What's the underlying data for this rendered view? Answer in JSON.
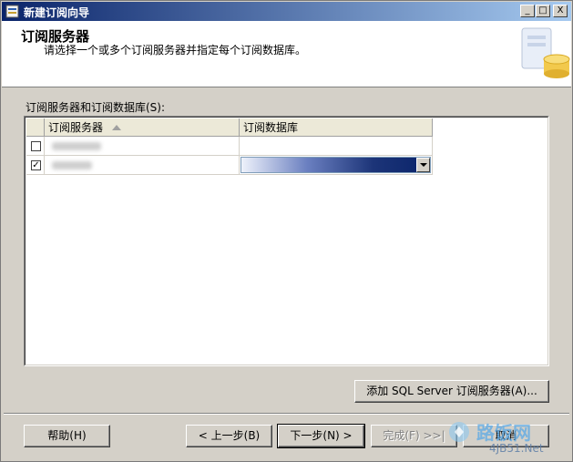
{
  "window": {
    "title": "新建订阅向导",
    "min_glyph": "_",
    "max_glyph": "□",
    "close_glyph": "X"
  },
  "header": {
    "title": "订阅服务器",
    "subtitle": "请选择一个或多个订阅服务器并指定每个订阅数据库。"
  },
  "grid": {
    "label": "订阅服务器和订阅数据库(S):",
    "columns": [
      "订阅服务器",
      "订阅数据库"
    ],
    "rows": [
      {
        "checked": false,
        "check_glyph": ""
      },
      {
        "checked": true,
        "check_glyph": "✓"
      }
    ]
  },
  "buttons": {
    "add": "添加 SQL Server 订阅服务器(A)...",
    "help": "帮助(H)",
    "back": "< 上一步(B)",
    "next": "下一步(N) >",
    "finish": "完成(F) >>|",
    "cancel": "取消"
  },
  "watermark": {
    "text": "路饭网",
    "url": "4JB51.Net"
  },
  "colors": {
    "title_start": "#0a246a",
    "title_end": "#a6caf0",
    "selection": "#0a246a",
    "face": "#d4d0c8"
  },
  "icons": [
    "wizard-app-icon",
    "database-wizard-graphic",
    "sort-ascending-icon",
    "dropdown-arrow-icon"
  ]
}
